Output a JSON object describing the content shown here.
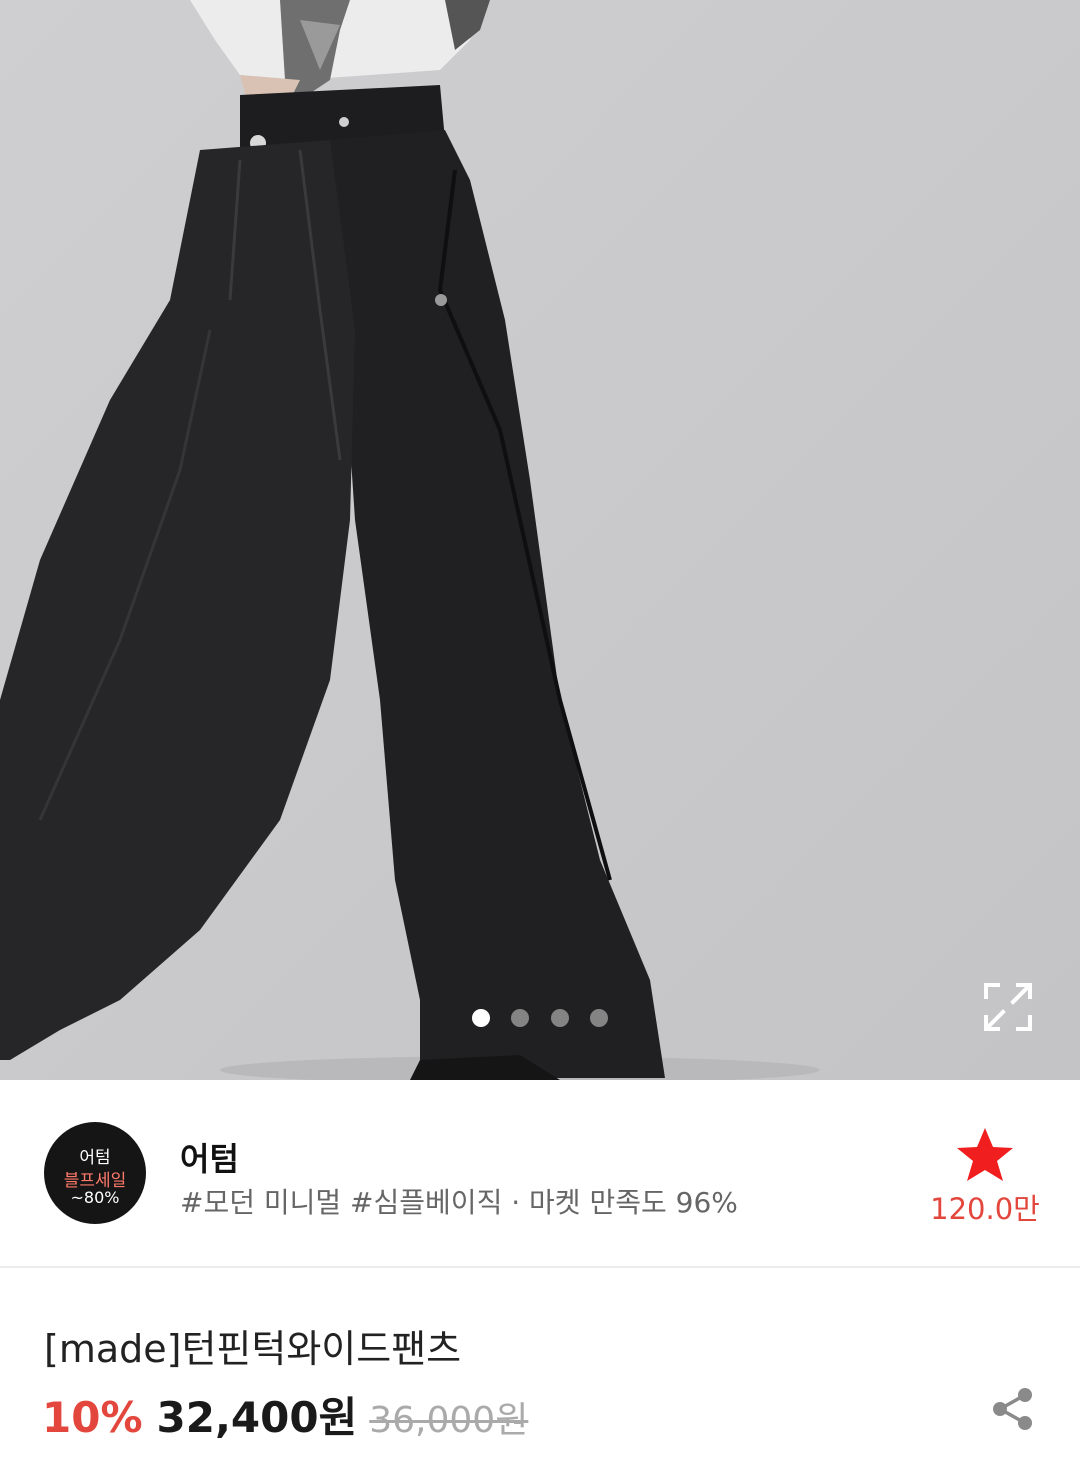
{
  "hero": {
    "image_subject": "black-wide-pleated-trousers-photo",
    "slide_count": 4,
    "active_slide": 1,
    "expand_icon": "expand-icon",
    "background_color": "#c9c9cb"
  },
  "shop": {
    "logo": {
      "line1": "어텀",
      "line2": "블프세일",
      "line3": "~80%"
    },
    "name": "어텀",
    "tags": "#모던 미니멀 #심플베이직 · 마켓 만족도 96%",
    "favorite_icon": "star-icon",
    "favorite_count": "120.0만"
  },
  "product": {
    "title": "[made]턴핀턱와이드팬츠",
    "discount": "10%",
    "price": "32,400원",
    "original_price": "36,000원",
    "share_icon": "share-icon"
  },
  "colors": {
    "accent": "#e3463c",
    "logo_bg": "#151515",
    "logo_highlight": "#ff7a6a"
  }
}
